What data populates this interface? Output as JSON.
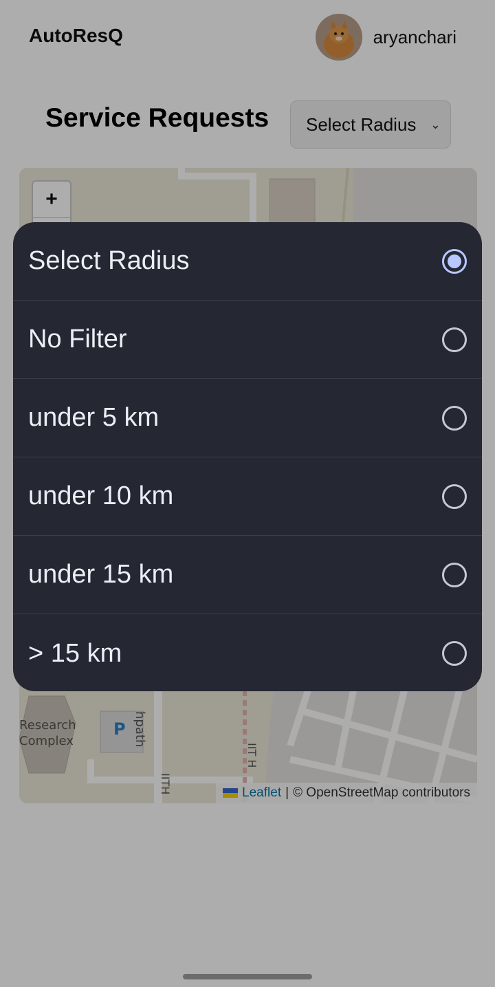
{
  "header": {
    "brand": "AutoResQ",
    "username": "aryanchari",
    "avatar_icon": "cat-avatar"
  },
  "main": {
    "title": "Service Requests",
    "radius_select": {
      "value": "Select Radius"
    }
  },
  "map": {
    "zoom_in": "+",
    "labels": {
      "research_line1": "Research",
      "research_line2": "Complex",
      "parking": "P",
      "path": "hpath",
      "road1": "IIT H",
      "road2": "IITH"
    },
    "attribution": {
      "leaflet": "Leaflet",
      "separator": "|",
      "osm": "© OpenStreetMap contributors"
    }
  },
  "dropdown": {
    "options": [
      {
        "label": "Select Radius",
        "selected": true
      },
      {
        "label": "No Filter",
        "selected": false
      },
      {
        "label": "under 5 km",
        "selected": false
      },
      {
        "label": "under 10 km",
        "selected": false
      },
      {
        "label": "under 15 km",
        "selected": false
      },
      {
        "label": "> 15 km",
        "selected": false
      }
    ]
  },
  "colors": {
    "sheet_bg": "#252733",
    "radio_selected": "#b9c7ff",
    "leaflet_link": "#0078a8"
  }
}
